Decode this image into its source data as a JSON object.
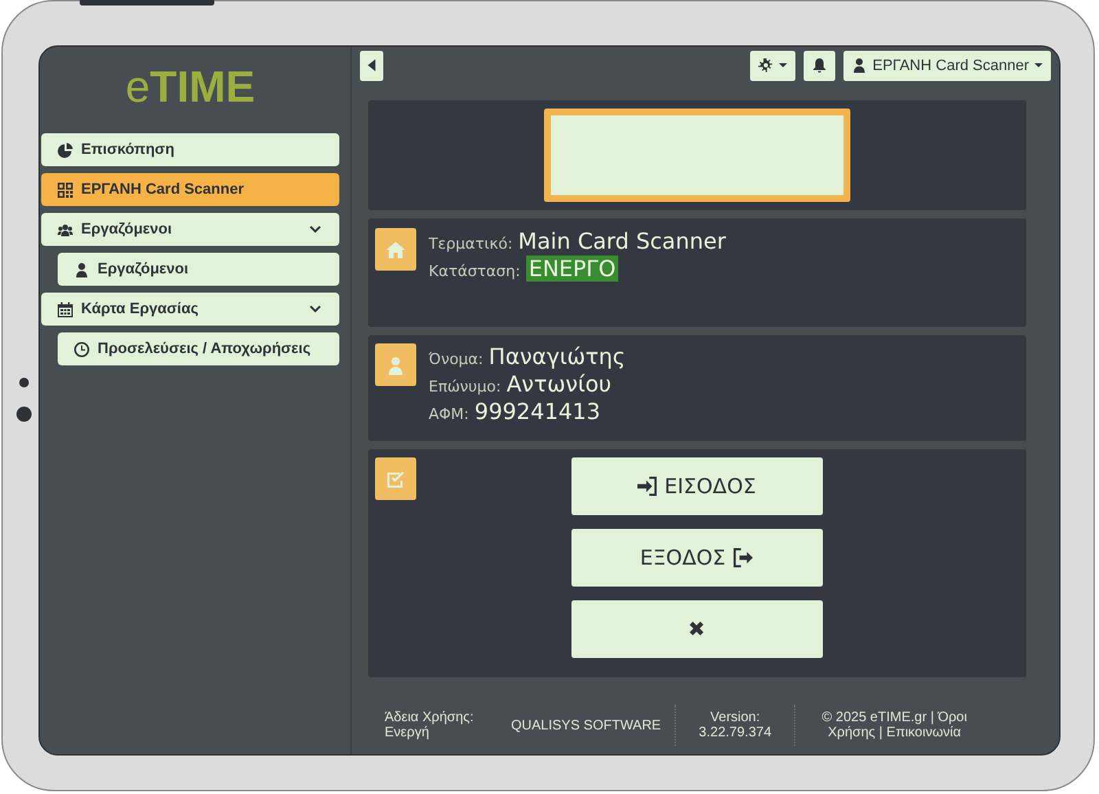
{
  "logo": {
    "text": "e**TIME**"
  },
  "sidebar": {
    "items": [
      {
        "label": "Επισκόπηση",
        "selected": false
      },
      {
        "label": "ΕΡΓΑΝΗ Card Scanner",
        "selected": true
      },
      {
        "label": "Εργαζόμενοι",
        "selected": false,
        "expanded": true,
        "children": [
          {
            "label": "Εργαζόμενοι",
            "selected": false
          }
        ]
      },
      {
        "label": "Κάρτα Εργασίας",
        "selected": false,
        "expanded": true,
        "children": [
          {
            "label": "Προσελεύσεις / Αποχωρήσεις",
            "selected": false
          }
        ]
      }
    ]
  },
  "top_bar": {
    "user": "ΕΡΓΑΝΗ Card Scanner"
  },
  "terminal": {
    "label": "Τερματικό:",
    "value": "Main Card Scanner",
    "status_label": "Κατάσταση:",
    "status": "ΕΝΕΡΓΟ",
    "active": true
  },
  "employee": {
    "fields": [
      {
        "label": "Όνομα:",
        "value": "Παναγιώτης"
      },
      {
        "label": "Επώνυμο:",
        "value": "Αντωνίου"
      },
      {
        "label": "ΑΦΜ:",
        "value": "999241413"
      }
    ]
  },
  "actions": [
    {
      "kind": "enter",
      "label": "ΕΙΣΟΔΟΣ"
    },
    {
      "kind": "exit",
      "label": "ΕΞΟΔΟΣ"
    },
    {
      "kind": "cancel",
      "label": "✖"
    }
  ],
  "footer": {
    "license_label": "Άδεια Χρήσης:",
    "license_value": "Ενεργή",
    "company": "QUALISYS SOFTWARE",
    "version_label": "Version:",
    "version": "3.22.79.374",
    "copyright": "© 2025 eTIME.gr | Όροι Χρήσης | Επικοινωνία"
  }
}
